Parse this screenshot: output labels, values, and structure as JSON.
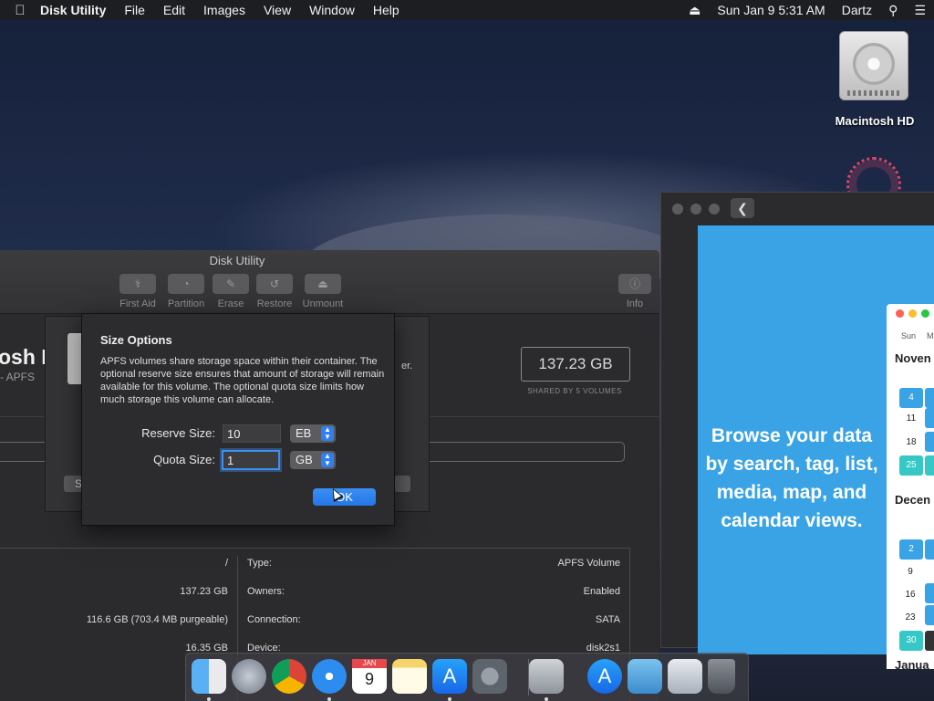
{
  "menubar": {
    "app_name": "Disk Utility",
    "menus": [
      "File",
      "Edit",
      "Images",
      "View",
      "Window",
      "Help"
    ],
    "clock": "Sun Jan 9  5:31 AM",
    "user": "Dartz"
  },
  "desktop": {
    "hd_label": "Macintosh HD"
  },
  "right_app": {
    "promo_text": "Browse your data by search, tag, list, media, map, and calendar views.",
    "calendar": {
      "day_headers": [
        "Sun",
        "M"
      ],
      "months": [
        "Noven",
        "Decen",
        "Janua"
      ],
      "numbers": [
        "4",
        "11",
        "18",
        "25",
        "2",
        "9",
        "16",
        "23",
        "30"
      ]
    }
  },
  "disk_utility": {
    "title": "Disk Utility",
    "toolbar": [
      {
        "label": "First Aid",
        "icon": "stethoscope-icon"
      },
      {
        "label": "Partition",
        "icon": "pie-icon"
      },
      {
        "label": "Erase",
        "icon": "erase-icon"
      },
      {
        "label": "Restore",
        "icon": "restore-icon"
      },
      {
        "label": "Unmount",
        "icon": "eject-icon"
      }
    ],
    "info_label": "Info",
    "volume_name": "osh H",
    "volume_sub": "- APFS",
    "capacity": "137.23 GB",
    "shared": "SHARED BY 5 VOLUMES",
    "info_left": [
      {
        "value": "/"
      },
      {
        "value": "137.23 GB"
      },
      {
        "value": "116.6 GB (703.4 MB purgeable)"
      },
      {
        "value": "16.35 GB"
      }
    ],
    "info_right": [
      {
        "label": "Type:",
        "value": "APFS Volume"
      },
      {
        "label": "Owners:",
        "value": "Enabled"
      },
      {
        "label": "Connection:",
        "value": "SATA"
      },
      {
        "label": "Device:",
        "value": "disk2s1"
      }
    ]
  },
  "back_sheet": {
    "left_button": "S",
    "right_text": "er."
  },
  "dialog": {
    "title": "Size Options",
    "description": "APFS volumes share storage space within their container. The optional reserve size ensures that amount of storage will remain available for this volume. The optional quota size limits how much storage this volume can allocate.",
    "reserve_label": "Reserve Size:",
    "reserve_value": "10",
    "reserve_unit": "EB",
    "quota_label": "Quota Size:",
    "quota_value": "1",
    "quota_unit": "GB",
    "ok_label": "OK"
  },
  "dock": {
    "calendar_month": "JAN",
    "calendar_day": "9"
  }
}
